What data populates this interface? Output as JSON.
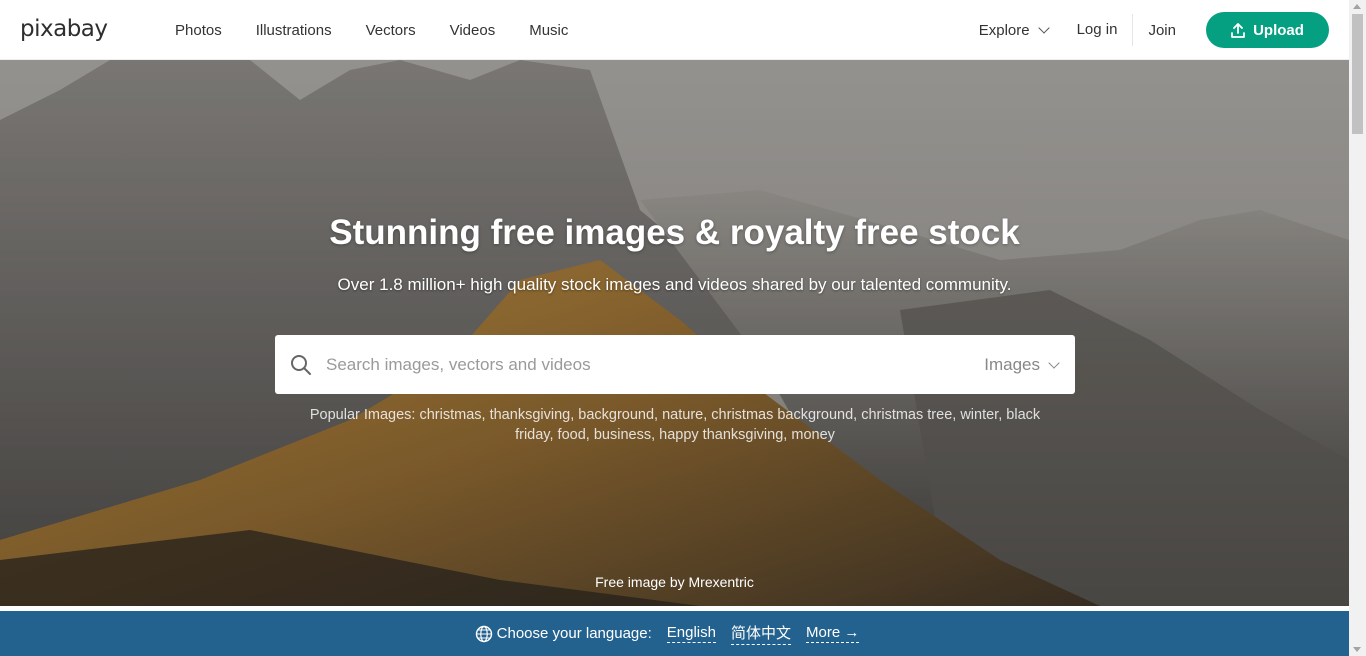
{
  "header": {
    "logo": "pixabay",
    "nav": [
      "Photos",
      "Illustrations",
      "Vectors",
      "Videos",
      "Music"
    ],
    "explore": "Explore",
    "login": "Log in",
    "join": "Join",
    "upload": "Upload"
  },
  "hero": {
    "title": "Stunning free images & royalty free stock",
    "subtitle": "Over 1.8 million+ high quality stock images and videos shared by our talented community.",
    "search_placeholder": "Search images, vectors and videos",
    "search_type": "Images",
    "popular_label": "Popular Images:",
    "popular_tags": [
      "christmas",
      "thanksgiving",
      "background",
      "nature",
      "christmas background",
      "christmas tree",
      "winter",
      "black friday",
      "food",
      "business",
      "happy thanksgiving",
      "money"
    ],
    "credit_prefix": "Free image by",
    "credit_author": "Mrexentric"
  },
  "language_bar": {
    "label": "Choose your language:",
    "options": [
      "English",
      "简体中文"
    ],
    "more": "More →"
  },
  "colors": {
    "upload_button": "#05a081",
    "language_bar": "#23628f"
  },
  "icons": {
    "upload": "upload-icon",
    "search": "search-icon",
    "globe": "globe-icon",
    "chevron": "chevron-down-icon"
  }
}
